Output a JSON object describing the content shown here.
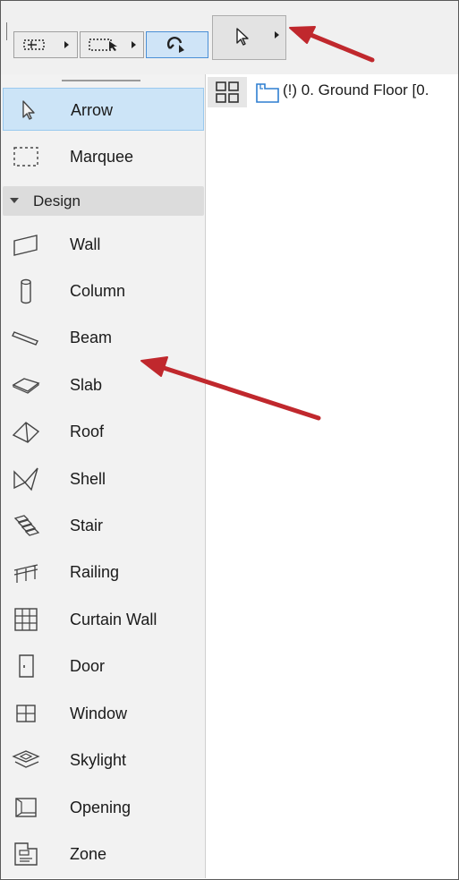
{
  "toolbar": {
    "buttons": [
      {
        "icon": "quick-options-icon"
      },
      {
        "icon": "marquee-options-icon"
      },
      {
        "icon": "magnet-snap-icon"
      }
    ],
    "active_tool_icon": "arrow-cursor-icon"
  },
  "sidebar": {
    "top_items": [
      {
        "label": "Arrow",
        "icon": "arrow-cursor-icon",
        "selected": true
      },
      {
        "label": "Marquee",
        "icon": "marquee-icon",
        "selected": false
      }
    ],
    "section": {
      "label": "Design",
      "expanded": true
    },
    "design_items": [
      {
        "label": "Wall",
        "icon": "wall-icon"
      },
      {
        "label": "Column",
        "icon": "column-icon"
      },
      {
        "label": "Beam",
        "icon": "beam-icon"
      },
      {
        "label": "Slab",
        "icon": "slab-icon"
      },
      {
        "label": "Roof",
        "icon": "roof-icon"
      },
      {
        "label": "Shell",
        "icon": "shell-icon"
      },
      {
        "label": "Stair",
        "icon": "stair-icon"
      },
      {
        "label": "Railing",
        "icon": "railing-icon"
      },
      {
        "label": "Curtain Wall",
        "icon": "curtain-wall-icon"
      },
      {
        "label": "Door",
        "icon": "door-icon"
      },
      {
        "label": "Window",
        "icon": "window-icon"
      },
      {
        "label": "Skylight",
        "icon": "skylight-icon"
      },
      {
        "label": "Opening",
        "icon": "opening-icon"
      },
      {
        "label": "Zone",
        "icon": "zone-icon"
      }
    ]
  },
  "view_tab": {
    "label": "(!) 0. Ground Floor [0.",
    "icon": "floor-plan-icon"
  },
  "colors": {
    "selection": "#cce4f7",
    "accent": "#4a8fd6",
    "annotation_arrow": "#c0282d"
  }
}
